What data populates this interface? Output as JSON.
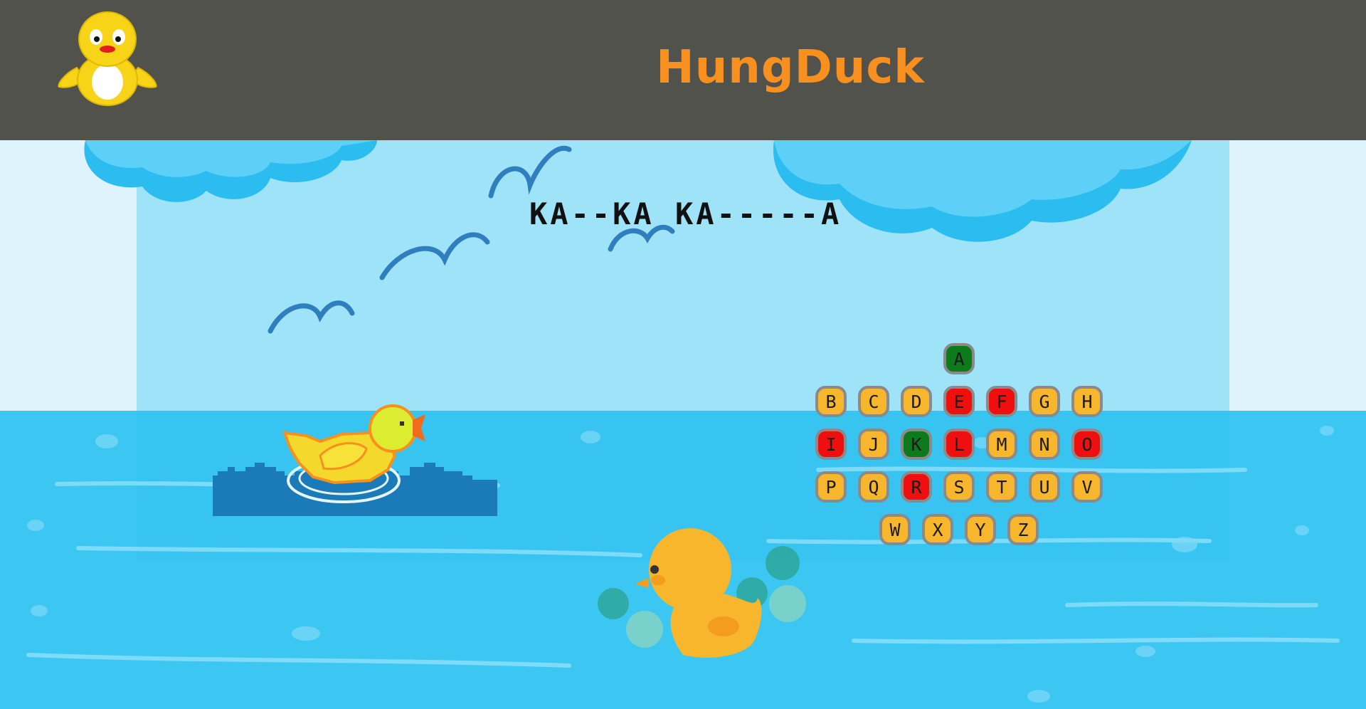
{
  "header": {
    "brand": "HungDuck",
    "logo_icon": "duck-logo-icon"
  },
  "game": {
    "word_display": "KA--KA KA-----A",
    "keyboard": {
      "rows": [
        [
          {
            "letter": "A",
            "state": "correct"
          }
        ],
        [
          {
            "letter": "B",
            "state": "default"
          },
          {
            "letter": "C",
            "state": "default"
          },
          {
            "letter": "D",
            "state": "default"
          },
          {
            "letter": "E",
            "state": "wrong"
          },
          {
            "letter": "F",
            "state": "wrong"
          },
          {
            "letter": "G",
            "state": "default"
          },
          {
            "letter": "H",
            "state": "default"
          }
        ],
        [
          {
            "letter": "I",
            "state": "wrong"
          },
          {
            "letter": "J",
            "state": "default"
          },
          {
            "letter": "K",
            "state": "correct"
          },
          {
            "letter": "L",
            "state": "wrong"
          },
          {
            "letter": "M",
            "state": "default"
          },
          {
            "letter": "N",
            "state": "default"
          },
          {
            "letter": "O",
            "state": "wrong"
          }
        ],
        [
          {
            "letter": "P",
            "state": "default"
          },
          {
            "letter": "Q",
            "state": "default"
          },
          {
            "letter": "R",
            "state": "wrong"
          },
          {
            "letter": "S",
            "state": "default"
          },
          {
            "letter": "T",
            "state": "default"
          },
          {
            "letter": "U",
            "state": "default"
          },
          {
            "letter": "V",
            "state": "default"
          }
        ],
        [
          {
            "letter": "W",
            "state": "default"
          },
          {
            "letter": "X",
            "state": "default"
          },
          {
            "letter": "Y",
            "state": "default"
          },
          {
            "letter": "Z",
            "state": "default"
          }
        ]
      ]
    }
  },
  "colors": {
    "header_bg": "#52524c",
    "brand": "#f7901e",
    "key_default": "#f7b62b",
    "key_correct": "#0d7a1c",
    "key_wrong": "#ef0f0f",
    "sky": "#9fe3f8",
    "sea": "#3cc7f2"
  }
}
